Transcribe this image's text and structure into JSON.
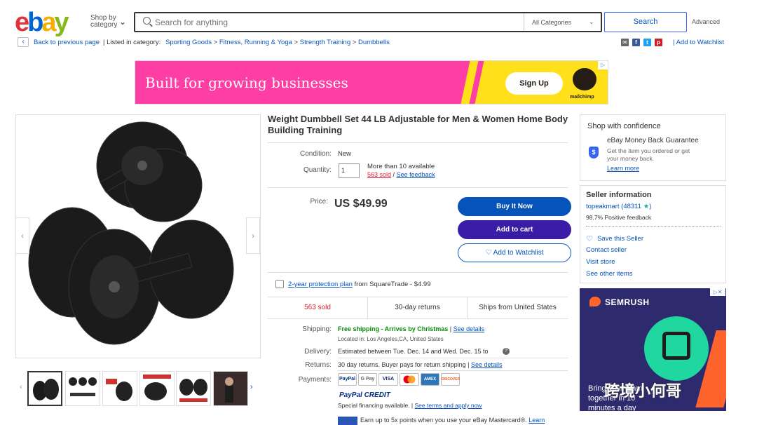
{
  "header": {
    "logo": {
      "e": "e",
      "b": "b",
      "a": "a",
      "y": "y"
    },
    "shop_by_line1": "Shop by",
    "shop_by_line2": "category",
    "search_placeholder": "Search for anything",
    "category_select": "All Categories",
    "search_button": "Search",
    "advanced": "Advanced"
  },
  "breadcrumb": {
    "back": "Back to previous page",
    "listed_in": "| Listed in category:",
    "items": [
      "Sporting Goods",
      "Fitness, Running & Yoga",
      "Strength Training",
      "Dumbbells"
    ],
    "sep": ">",
    "add_to_watchlist": "| Add to Watchlist"
  },
  "ad_top": {
    "headline": "Built for growing businesses",
    "cta": "Sign Up",
    "brand": "mailchimp",
    "badge": "▷"
  },
  "product": {
    "title": "Weight Dumbbell Set 44 LB Adjustable for Men & Women Home Body Building Training",
    "condition_label": "Condition:",
    "condition_value": "New",
    "quantity_label": "Quantity:",
    "quantity_value": "1",
    "availability": "More than 10 available",
    "sold": "563 sold",
    "see_feedback": "See feedback",
    "slash": "/",
    "price_label": "Price:",
    "price": "US $49.99",
    "buy_now": "Buy It Now",
    "add_to_cart": "Add to cart",
    "add_to_watchlist": "♡ Add to Watchlist",
    "protection_link": "2-year protection plan",
    "protection_rest": "from SquareTrade - $4.99",
    "strip": [
      "563 sold",
      "30-day returns",
      "Ships from United States"
    ],
    "shipping_label": "Shipping:",
    "shipping_value": "Free shipping - Arrives by Christmas",
    "see_details": "See details",
    "located": "Located in: Los Angeles,CA, United States",
    "delivery_label": "Delivery:",
    "delivery_value": "Estimated between Tue. Dec. 14 and Wed. Dec. 15 to",
    "returns_label": "Returns:",
    "returns_value": "30 day returns. Buyer pays for return shipping |",
    "payments_label": "Payments:",
    "payment_methods": [
      "PayPal",
      "G Pay",
      "VISA",
      "MC",
      "AMEX",
      "DISCOVER"
    ],
    "paypal_credit": "PayPal CREDIT",
    "special_financing": "Special financing available.",
    "see_terms": "See terms and apply now",
    "mastercard_promo": "Earn up to 5x points when you use your eBay Mastercard®.",
    "learn": "Learn"
  },
  "gallery": {
    "prev": "‹",
    "next": "›",
    "thumb_next": "›",
    "thumb_prev": "‹",
    "thumbs": 6
  },
  "confidence": {
    "title": "Shop with confidence",
    "guarantee": "eBay Money Back Guarantee",
    "desc_line1": "Get the item you ordered or get",
    "desc_line2": "your money back.",
    "learn_more": "Learn more"
  },
  "seller": {
    "title": "Seller information",
    "name": "topeakmart",
    "score": "(48311",
    "star": "★",
    "close": ")",
    "positive": "98.7% Positive feedback",
    "save": "Save this Seller",
    "contact": "Contact seller",
    "visit": "Visit store",
    "other": "See other items"
  },
  "ad_side": {
    "brand": "SEMRUSH",
    "text": "Bring your team together in 10 minutes a day",
    "badge": "▷✕"
  },
  "watermark": "跨境小何哥",
  "colors": {
    "ebay_blue": "#0654ba",
    "buy_now": "#0654ba",
    "add_to_cart": "#3a1da6",
    "sold_red": "#dd1e31",
    "green": "#0a8a0a"
  }
}
